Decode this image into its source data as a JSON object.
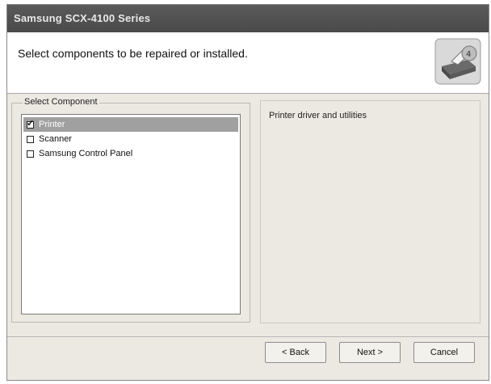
{
  "window": {
    "title": "Samsung SCX-4100 Series"
  },
  "header": {
    "heading": "Select components to be repaired or installed.",
    "logo_icon": "printer-icon"
  },
  "components": {
    "legend": "Select Component",
    "items": [
      {
        "label": "Printer",
        "checked": true,
        "selected": true
      },
      {
        "label": "Scanner",
        "checked": false,
        "selected": false
      },
      {
        "label": "Samsung Control Panel",
        "checked": false,
        "selected": false
      }
    ]
  },
  "description": {
    "text": "Printer driver and utilities"
  },
  "buttons": {
    "back": "< Back",
    "next": "Next >",
    "cancel": "Cancel"
  }
}
